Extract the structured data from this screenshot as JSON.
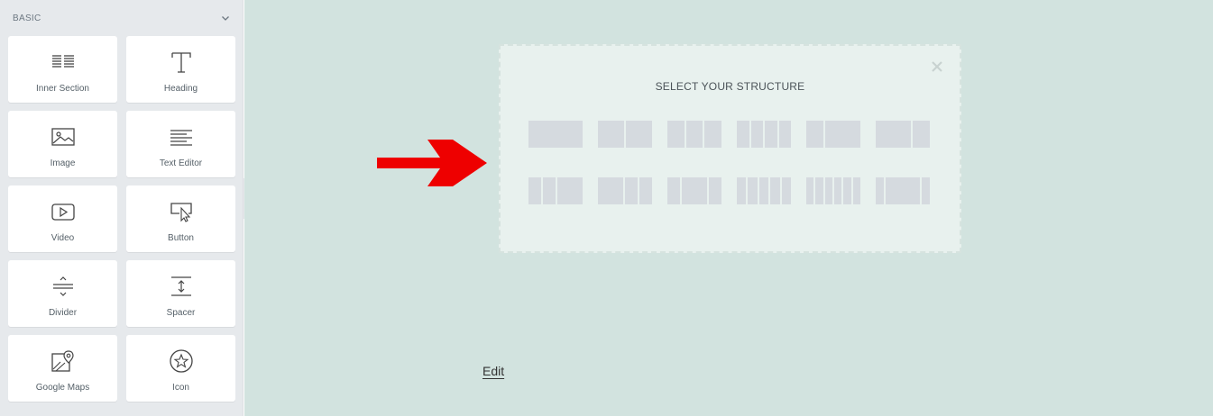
{
  "sidebar": {
    "category_label": "BASIC",
    "widgets": [
      {
        "label": "Inner Section",
        "icon": "inner-section-icon"
      },
      {
        "label": "Heading",
        "icon": "heading-icon"
      },
      {
        "label": "Image",
        "icon": "image-icon"
      },
      {
        "label": "Text Editor",
        "icon": "text-editor-icon"
      },
      {
        "label": "Video",
        "icon": "video-icon"
      },
      {
        "label": "Button",
        "icon": "button-icon"
      },
      {
        "label": "Divider",
        "icon": "divider-icon"
      },
      {
        "label": "Spacer",
        "icon": "spacer-icon"
      },
      {
        "label": "Google Maps",
        "icon": "google-maps-icon"
      },
      {
        "label": "Icon",
        "icon": "star-icon"
      }
    ]
  },
  "structure_panel": {
    "title": "SELECT YOUR STRUCTURE",
    "presets": [
      {
        "name": "one-column",
        "columns": [
          100
        ]
      },
      {
        "name": "two-columns",
        "columns": [
          50,
          50
        ]
      },
      {
        "name": "three-columns",
        "columns": [
          33,
          33,
          33
        ]
      },
      {
        "name": "four-columns",
        "columns": [
          25,
          25,
          25,
          25
        ]
      },
      {
        "name": "one-third-two-thirds",
        "columns": [
          33,
          66
        ]
      },
      {
        "name": "two-thirds-one-third",
        "columns": [
          66,
          33
        ]
      },
      {
        "name": "quarter-quarter-half",
        "columns": [
          25,
          25,
          50
        ]
      },
      {
        "name": "half-quarter-quarter",
        "columns": [
          50,
          25,
          25
        ]
      },
      {
        "name": "quarter-half-quarter",
        "columns": [
          25,
          50,
          25
        ]
      },
      {
        "name": "five-columns",
        "columns": [
          20,
          20,
          20,
          20,
          20
        ]
      },
      {
        "name": "six-columns",
        "columns": [
          16,
          16,
          16,
          16,
          16,
          16
        ]
      },
      {
        "name": "sixth-twothirds-sixth",
        "columns": [
          16,
          66,
          16
        ]
      }
    ]
  },
  "canvas": {
    "edit_link": "Edit"
  },
  "colors": {
    "canvas_bg": "#d2e3df",
    "arrow": "#ee0000",
    "panel_bg": "#e8f1ee"
  }
}
